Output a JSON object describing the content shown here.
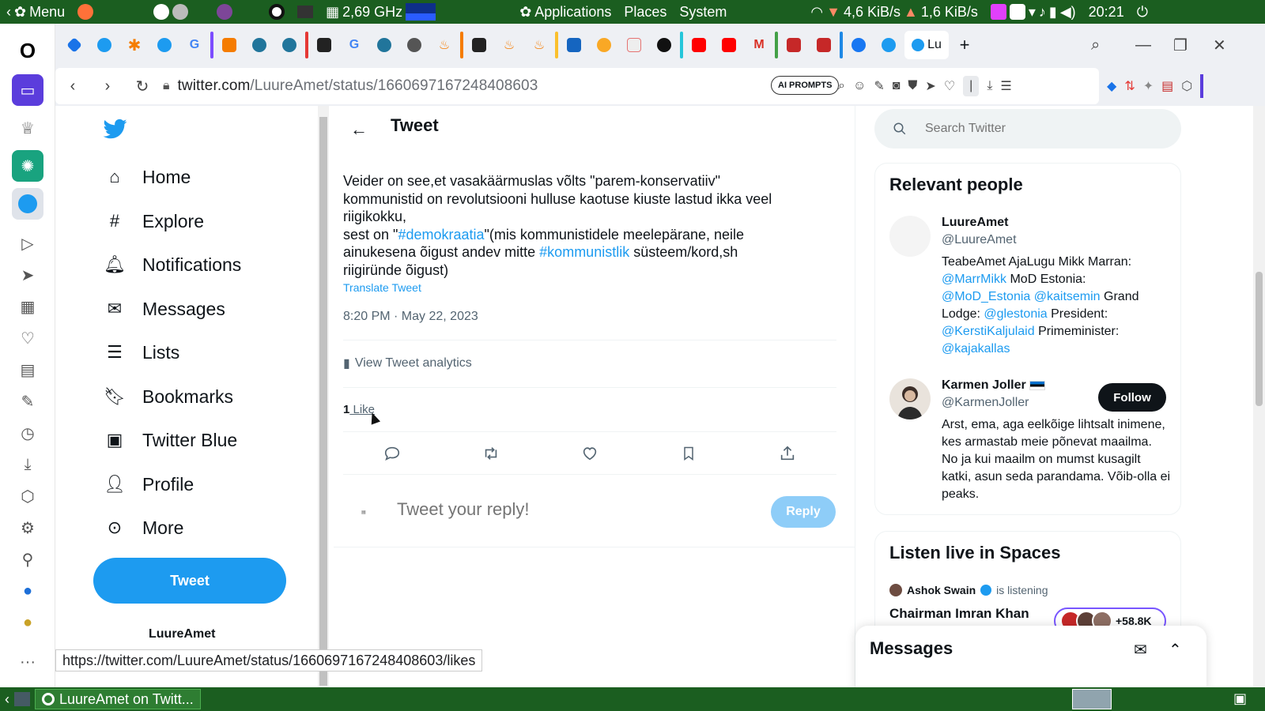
{
  "system_panel": {
    "menu_label": "Menu",
    "cpu_freq": "2,69 GHz",
    "applications": "Applications",
    "places": "Places",
    "system": "System",
    "net_down": "4,6 KiB/s",
    "net_up": "1,6 KiB/s",
    "clock": "20:21"
  },
  "browser": {
    "url_domain": "twitter.com",
    "url_path": "/LuureAmet/status/1660697167248408603",
    "ai_prompts": "AI PROMPTS",
    "active_tab_title": "Lu",
    "status_url": "https://twitter.com/LuureAmet/status/1660697167248408603/likes"
  },
  "nav": {
    "items": [
      {
        "label": "Home",
        "icon": "home-icon"
      },
      {
        "label": "Explore",
        "icon": "hashtag-icon"
      },
      {
        "label": "Notifications",
        "icon": "bell-icon"
      },
      {
        "label": "Messages",
        "icon": "mail-icon"
      },
      {
        "label": "Lists",
        "icon": "list-icon"
      },
      {
        "label": "Bookmarks",
        "icon": "bookmark-icon"
      },
      {
        "label": "Twitter Blue",
        "icon": "twitter-blue-icon"
      },
      {
        "label": "Profile",
        "icon": "person-icon"
      },
      {
        "label": "More",
        "icon": "more-circle-icon"
      }
    ],
    "tweet_button": "Tweet",
    "account_name": "LuureAmet"
  },
  "main": {
    "title": "Tweet",
    "tweet": {
      "line1": "Veider on see,et vasakäärmuslas võlts \"parem-konservatiiv\"",
      "line2": "kommunistid on revolutsiooni hulluse kaotuse kiuste lastud ikka veel",
      "line3": "riigikokku,",
      "line4_a": "sest on \"",
      "hashtag1": "#demokraatia",
      "line4_b": "\"(mis kommunistidele meelepärane, neile",
      "line5_a": "ainukesena õigust andev mitte ",
      "hashtag2": "#kommunistlik",
      "line5_b": " süsteem/kord,sh",
      "line6": "riigiründe õigust)"
    },
    "translate": "Translate Tweet",
    "timestamp": "8:20 PM · May 22, 2023",
    "analytics": "View Tweet analytics",
    "likes_count": "1",
    "likes_label": " Like",
    "reply_placeholder": "Tweet your reply!",
    "reply_button": "Reply"
  },
  "right": {
    "search_placeholder": "Search Twitter",
    "relevant_title": "Relevant people",
    "people": [
      {
        "name": "LuureAmet",
        "handle": "@LuureAmet",
        "bio_1": "TeabeAmet AjaLugu Mikk Marran: ",
        "bio_m1": "@MarrMikk",
        "bio_2": " MoD Estonia: ",
        "bio_m2": "@MoD_Estonia",
        "bio_sp": " ",
        "bio_m3": "@kaitsemin",
        "bio_3": " Grand Lodge: ",
        "bio_m4": "@glestonia",
        "bio_4": " President: ",
        "bio_m5": "@KerstiKaljulaid",
        "bio_5": " Primeminister: ",
        "bio_m6": "@kajakallas"
      },
      {
        "name": "Karmen Joller",
        "handle": "@KarmenJoller",
        "bio": "Arst, ema, aga eelkõige lihtsalt inimene, kes armastab meie põnevat maailma. No ja kui maailm on mumst kusagilt katki, asun seda parandama. Võib-olla ei peaks.",
        "follow": "Follow"
      }
    ],
    "spaces_title": "Listen live in Spaces",
    "spaces_host": "Ashok Swain",
    "spaces_status": "is listening",
    "spaces_name": "Chairman Imran Khan",
    "spaces_count": "+58.8K",
    "messages_title": "Messages"
  },
  "taskbar": {
    "window_title": "LuureAmet on Twitt..."
  },
  "colors": {
    "twitter_blue": "#1d9bf0",
    "panel_green": "#1b5e20"
  }
}
